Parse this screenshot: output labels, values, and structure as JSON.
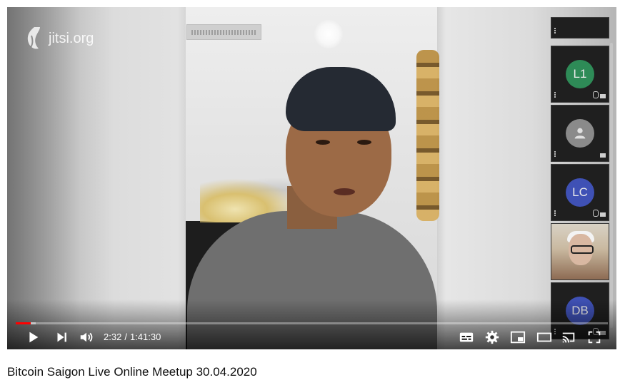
{
  "watermark": {
    "text": "jitsi.org",
    "icon": "jitsi-logo-icon"
  },
  "player": {
    "progress_fraction": 0.0258,
    "buffered_fraction": 0.034,
    "time": {
      "current": "2:32",
      "separator": "/",
      "duration": "1:41:30"
    },
    "controls": [
      "play-icon",
      "next-icon",
      "volume-icon",
      "subtitles-icon",
      "settings-icon",
      "miniplayer-icon",
      "theater-icon",
      "cast-icon",
      "fullscreen-icon"
    ]
  },
  "participants": [
    {
      "initials": "L1",
      "color": "#2e8b57"
    },
    {
      "initials": "",
      "color": "#8a8a8a",
      "icon": "person-icon"
    },
    {
      "initials": "LC",
      "color": "#3f51b5"
    },
    {
      "initials": "",
      "photo": true
    },
    {
      "initials": "DB",
      "color": "#3f51b5"
    }
  ],
  "title": "Bitcoin Saigon Live Online Meetup 30.04.2020"
}
